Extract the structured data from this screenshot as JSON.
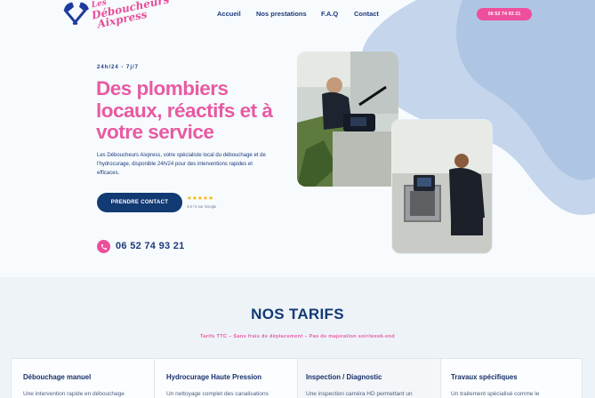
{
  "brand": {
    "logo_line1": "Les",
    "logo_line2": "Déboucheurs",
    "logo_line3": "Aixpress",
    "primary_color": "#ee4f9c",
    "navy_color": "#123a73"
  },
  "nav": {
    "items": [
      {
        "label": "Accueil"
      },
      {
        "label": "Nos prestations"
      },
      {
        "label": "F.A.Q"
      },
      {
        "label": "Contact"
      }
    ],
    "phone_button": "06 52 74 93 21"
  },
  "hero": {
    "kicker": "24h/24 - 7j/7",
    "title": "Des plombiers locaux, réactifs et à votre service",
    "description": "Les Déboucheurs Aixpress, votre spécialiste local du débouchage et de l'hydrocurage, disponible 24h/24 pour des interventions rapides et efficaces.",
    "cta_label": "PRENDRE CONTACT",
    "stars": "★★★★★",
    "rating_text": "4.8 / 5 sur Google",
    "phone": "06 52 74 93 21",
    "phone_icon": "phone-icon"
  },
  "tarifs": {
    "title": "NOS TARIFS",
    "subtitle": "Tarifs TTC – Sans frais de déplacement – Pas de majoration soir/week-end",
    "cards": [
      {
        "title": "Débouchage manuel",
        "desc": "Une intervention rapide en débouchage"
      },
      {
        "title": "Hydrocurage Haute Pression",
        "desc": "Un nettoyage complet des canalisations"
      },
      {
        "title": "Inspection / Diagnostic",
        "desc": "Une inspection caméra HD permettant un"
      },
      {
        "title": "Travaux spécifiques",
        "desc": "Un traitement spécialisé comme le"
      }
    ]
  }
}
